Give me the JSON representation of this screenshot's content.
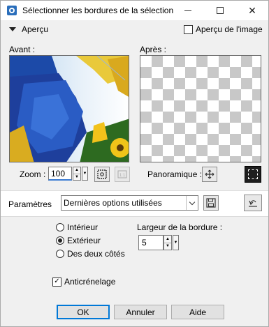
{
  "window": {
    "title": "Sélectionner les bordures de la sélection"
  },
  "preview_toggle": {
    "label": "Aperçu",
    "expanded": true
  },
  "preview_on_image": {
    "label": "Aperçu de l'image",
    "checked": false
  },
  "before": {
    "label": "Avant :"
  },
  "after": {
    "label": "Après :"
  },
  "zoom": {
    "label": "Zoom :",
    "value": "100"
  },
  "pan": {
    "label": "Panoramique :"
  },
  "params": {
    "label": "Paramètres",
    "preset": "Dernières options utilisées"
  },
  "options": {
    "interior": "Intérieur",
    "exterior": "Extérieur",
    "both": "Des deux côtés",
    "selected": "exterior"
  },
  "border_width": {
    "label": "Largeur de la bordure :",
    "value": "5"
  },
  "antialias": {
    "label": "Anticrénelage",
    "checked": true
  },
  "buttons": {
    "ok": "OK",
    "cancel": "Annuler",
    "help": "Aide"
  },
  "colors": {
    "accent": "#0078d7",
    "default_button_border": "#0078d7"
  }
}
